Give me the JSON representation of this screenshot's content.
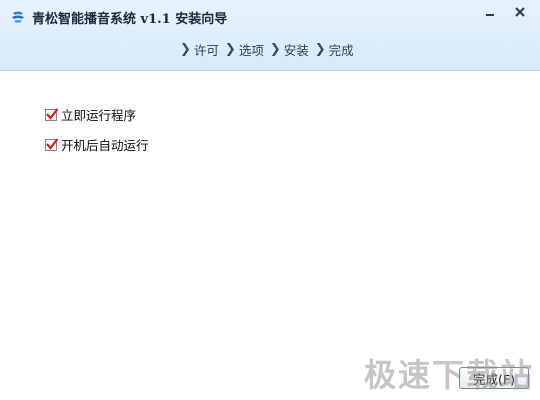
{
  "window": {
    "title": "青松智能播音系统 v1.1 安装向导",
    "app_icon": "app-logo-icon",
    "minimize_icon": "minimize-icon",
    "close_icon": "close-icon"
  },
  "steps": [
    {
      "label": "许可"
    },
    {
      "label": "选项"
    },
    {
      "label": "安装"
    },
    {
      "label": "完成"
    }
  ],
  "options": [
    {
      "label": "立即运行程序",
      "checked": true
    },
    {
      "label": "开机后自动运行",
      "checked": true
    }
  ],
  "buttons": {
    "finish_label": "完成(F)"
  },
  "watermark": "极速下载站",
  "colors": {
    "header_bg": "#d7eaf8",
    "check_mark": "#d42020"
  }
}
